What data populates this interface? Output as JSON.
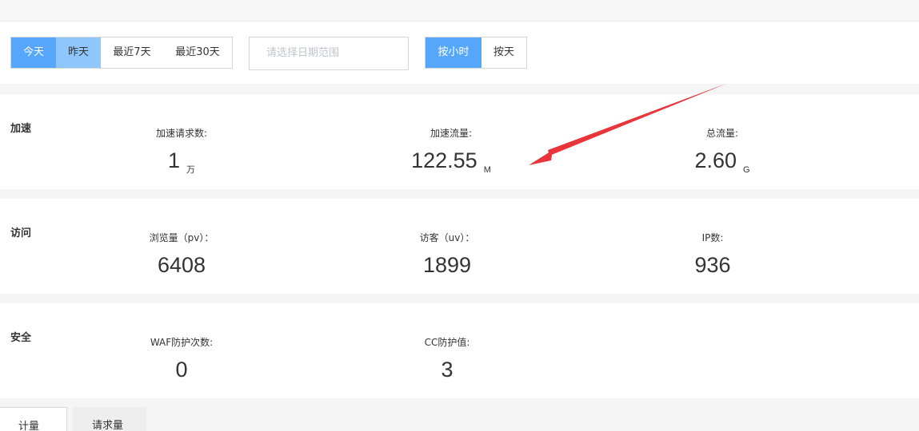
{
  "toolbar": {
    "range_buttons": [
      "今天",
      "昨天",
      "最近7天",
      "最近30天"
    ],
    "date_placeholder": "请选择日期范围",
    "granularity_buttons": [
      "按小时",
      "按天"
    ]
  },
  "sections": {
    "accel": {
      "title": "加速",
      "requests": {
        "label": "加速请求数:",
        "value": "1",
        "unit": "万"
      },
      "traffic": {
        "label": "加速流量:",
        "value": "122.55",
        "unit": "M"
      },
      "total": {
        "label": "总流量:",
        "value": "2.60",
        "unit": "G"
      }
    },
    "visits": {
      "title": "访问",
      "pv": {
        "label": "浏览量（pv）：",
        "value": "6408"
      },
      "uv": {
        "label": "访客（uv）：",
        "value": "1899"
      },
      "ip": {
        "label": "IP数:",
        "value": "936"
      }
    },
    "security": {
      "title": "安全",
      "waf": {
        "label": "WAF防护次数:",
        "value": "0"
      },
      "cc": {
        "label": "CC防护值:",
        "value": "3"
      }
    }
  },
  "bottom_tabs": [
    "计量",
    "请求量"
  ],
  "colors": {
    "primary": "#56a7fb",
    "hover": "#8fc6fc",
    "annotation_arrow": "#e8343a"
  }
}
